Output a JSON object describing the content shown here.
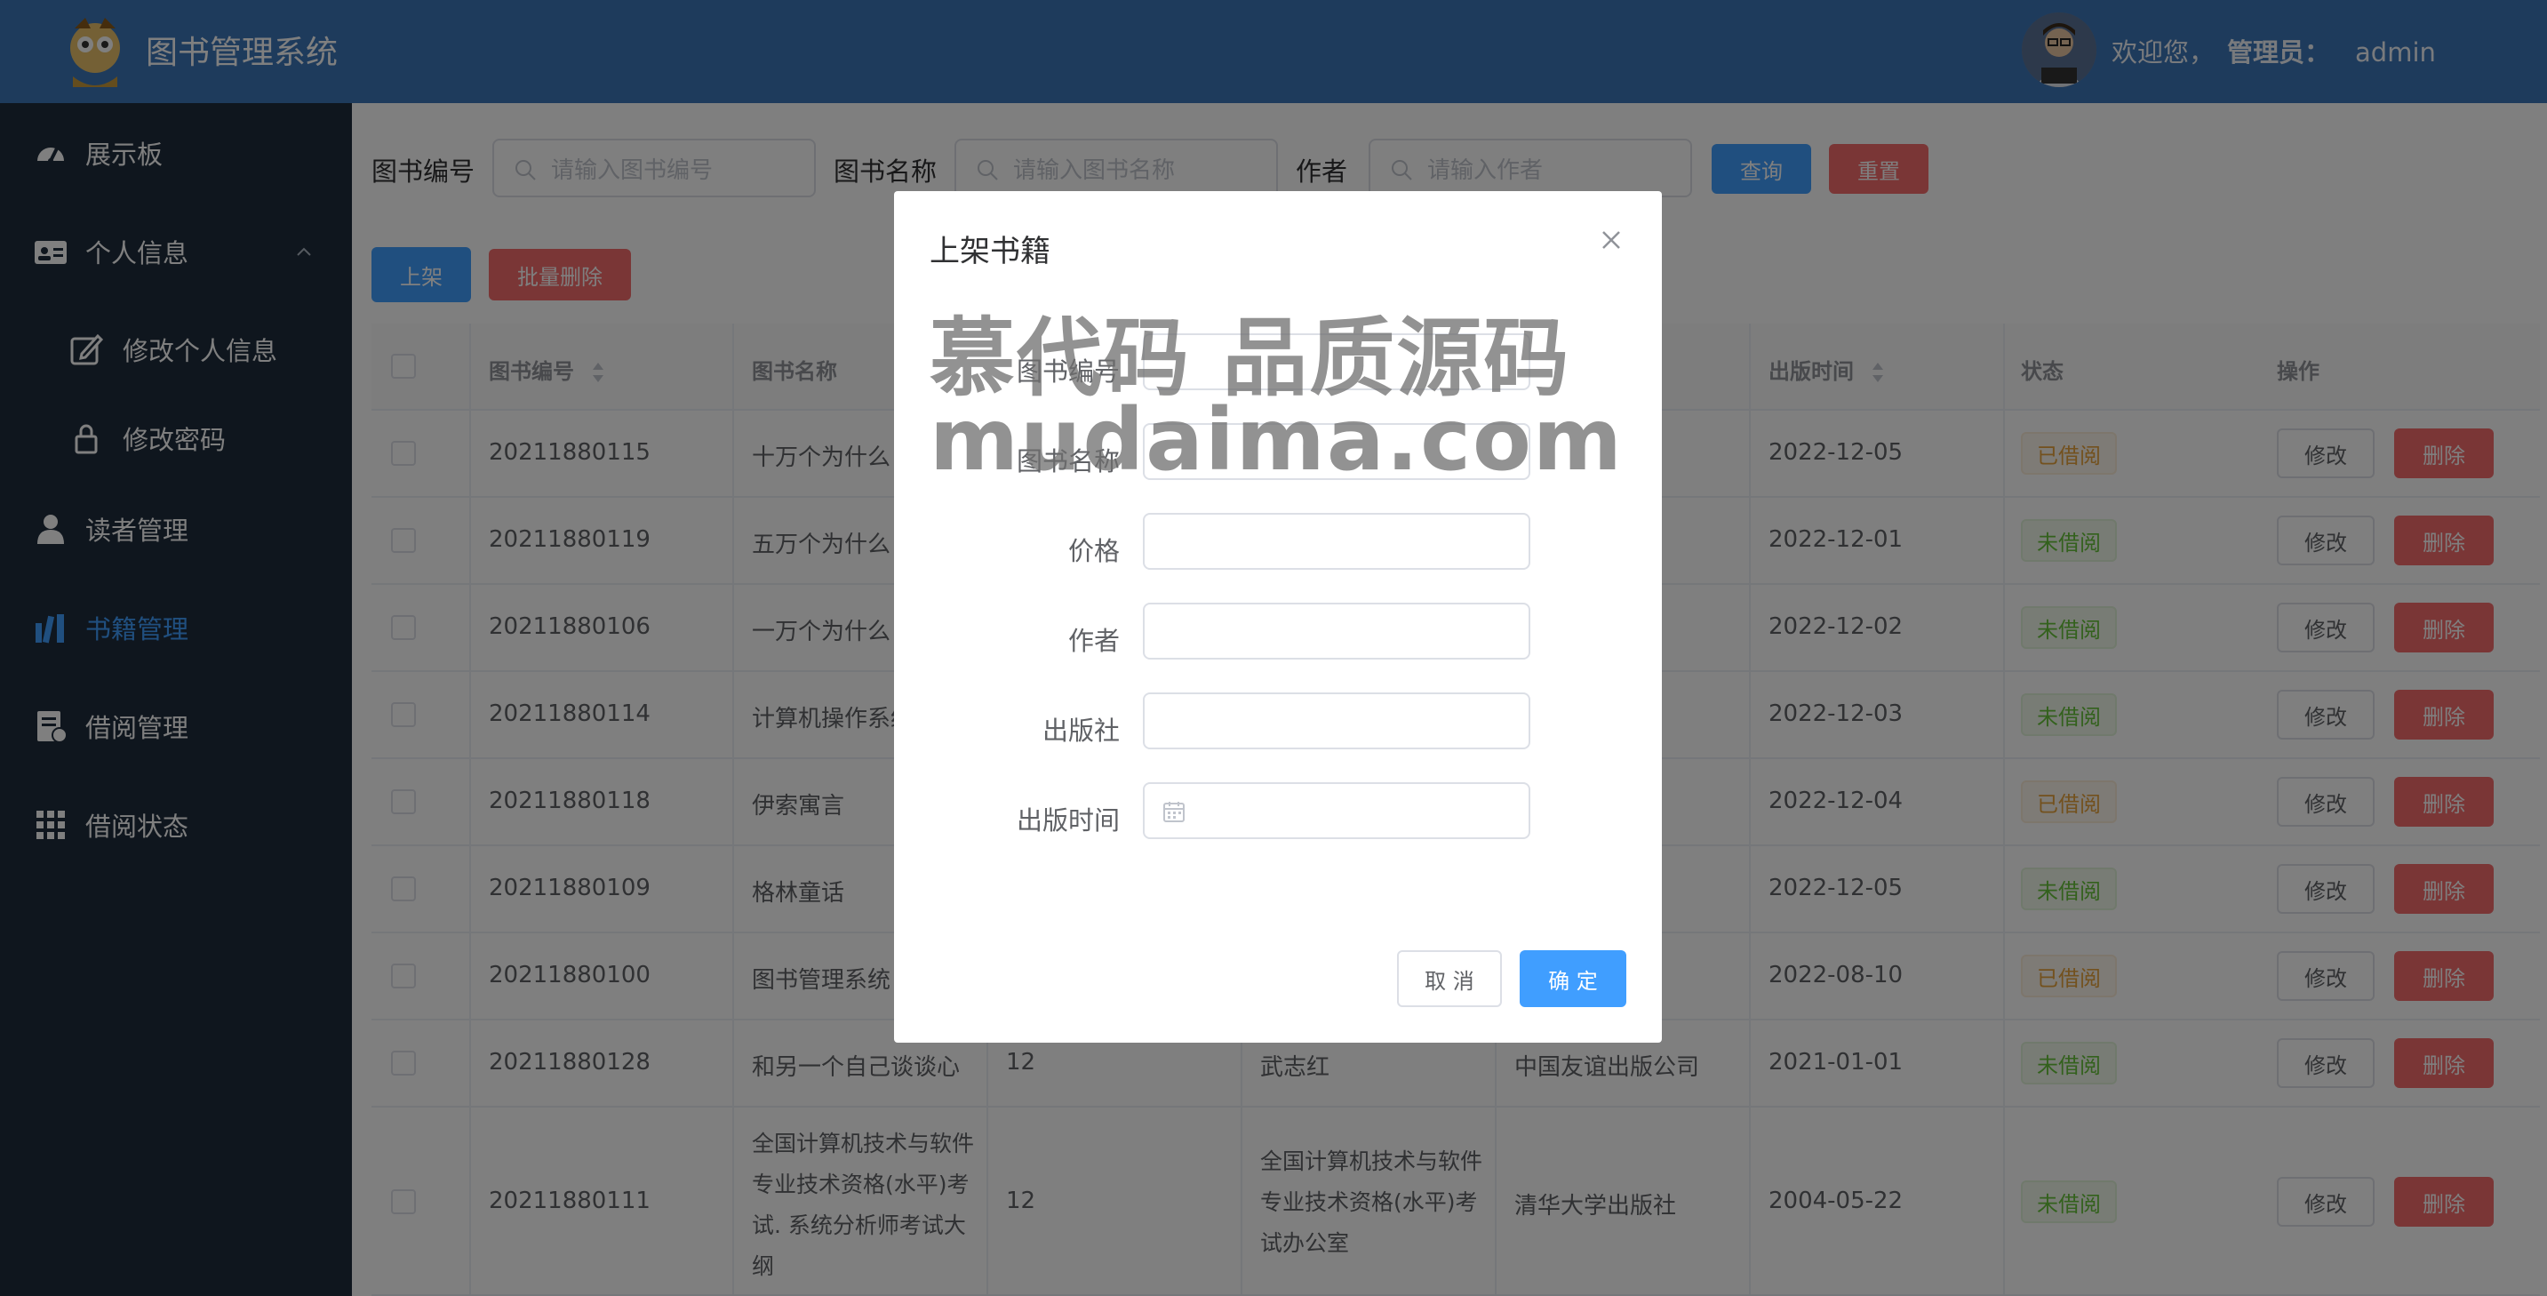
{
  "header": {
    "app_title": "图书管理系统",
    "welcome": "欢迎您，",
    "role": "管理员：",
    "username": "admin"
  },
  "sidebar": {
    "items": [
      {
        "label": "展示板",
        "icon": "dashboard-icon"
      },
      {
        "label": "个人信息",
        "icon": "id-card-icon"
      },
      {
        "label": "修改个人信息",
        "icon": "edit-icon"
      },
      {
        "label": "修改密码",
        "icon": "lock-icon"
      },
      {
        "label": "读者管理",
        "icon": "user-icon"
      },
      {
        "label": "书籍管理",
        "icon": "books-icon"
      },
      {
        "label": "借阅管理",
        "icon": "document-icon"
      },
      {
        "label": "借阅状态",
        "icon": "grid-icon"
      }
    ]
  },
  "search": {
    "book_id_label": "图书编号",
    "book_id_placeholder": "请输入图书编号",
    "book_name_label": "图书名称",
    "book_name_placeholder": "请输入图书名称",
    "author_label": "作者",
    "author_placeholder": "请输入作者",
    "query_button": "查询",
    "reset_button": "重置"
  },
  "toolbar": {
    "add_button": "上架",
    "batch_delete_button": "批量删除"
  },
  "table": {
    "headers": {
      "id": "图书编号",
      "name": "图书名称",
      "publish_date": "出版时间",
      "status": "状态",
      "actions": "操作"
    },
    "edit_label": "修改",
    "delete_label": "删除",
    "rows": [
      {
        "id": "20211880115",
        "name": "十万个为什么",
        "date": "2022-12-05",
        "status": "已借阅"
      },
      {
        "id": "20211880119",
        "name": "五万个为什么",
        "date": "2022-12-01",
        "status": "未借阅"
      },
      {
        "id": "20211880106",
        "name": "一万个为什么",
        "date": "2022-12-02",
        "status": "未借阅"
      },
      {
        "id": "20211880114",
        "name": "计算机操作系统",
        "date": "2022-12-03",
        "status": "未借阅"
      },
      {
        "id": "20211880118",
        "name": "伊索寓言",
        "date": "2022-12-04",
        "status": "已借阅"
      },
      {
        "id": "20211880109",
        "name": "格林童话",
        "date": "2022-12-05",
        "status": "未借阅"
      },
      {
        "id": "20211880100",
        "name": "图书管理系统",
        "date": "2022-08-10",
        "status": "已借阅"
      },
      {
        "id": "20211880128",
        "name": "和另一个自己谈谈心",
        "price": "12",
        "author": "武志红",
        "publisher": "中国友谊出版公司",
        "date": "2021-01-01",
        "status": "未借阅"
      },
      {
        "id": "20211880111",
        "name_lines": [
          "全国计算机技术与软件",
          "专业技术资格(水平)考",
          "试. 系统分析师考试大",
          "纲"
        ],
        "price": "12",
        "author_lines": [
          "全国计算机技术与软件",
          "专业技术资格(水平)考",
          "试办公室"
        ],
        "publisher": "清华大学出版社",
        "date": "2004-05-22",
        "status": "未借阅"
      }
    ]
  },
  "dialog": {
    "title": "上架书籍",
    "fields": [
      {
        "label": "图书编号",
        "value": ""
      },
      {
        "label": "图书名称",
        "value": ""
      },
      {
        "label": "价格",
        "value": ""
      },
      {
        "label": "作者",
        "value": ""
      },
      {
        "label": "出版社",
        "value": ""
      },
      {
        "label": "出版时间",
        "value": ""
      }
    ],
    "cancel_button": "取 消",
    "confirm_button": "确 定"
  },
  "watermark": {
    "line1": "慕代码 品质源码",
    "line2": "mudaima.com"
  },
  "colors": {
    "header": "#3d76b9",
    "sidebar": "#1f2d3d",
    "primary": "#409eff",
    "danger": "#f56c6c",
    "active_menu": "#409eff"
  }
}
